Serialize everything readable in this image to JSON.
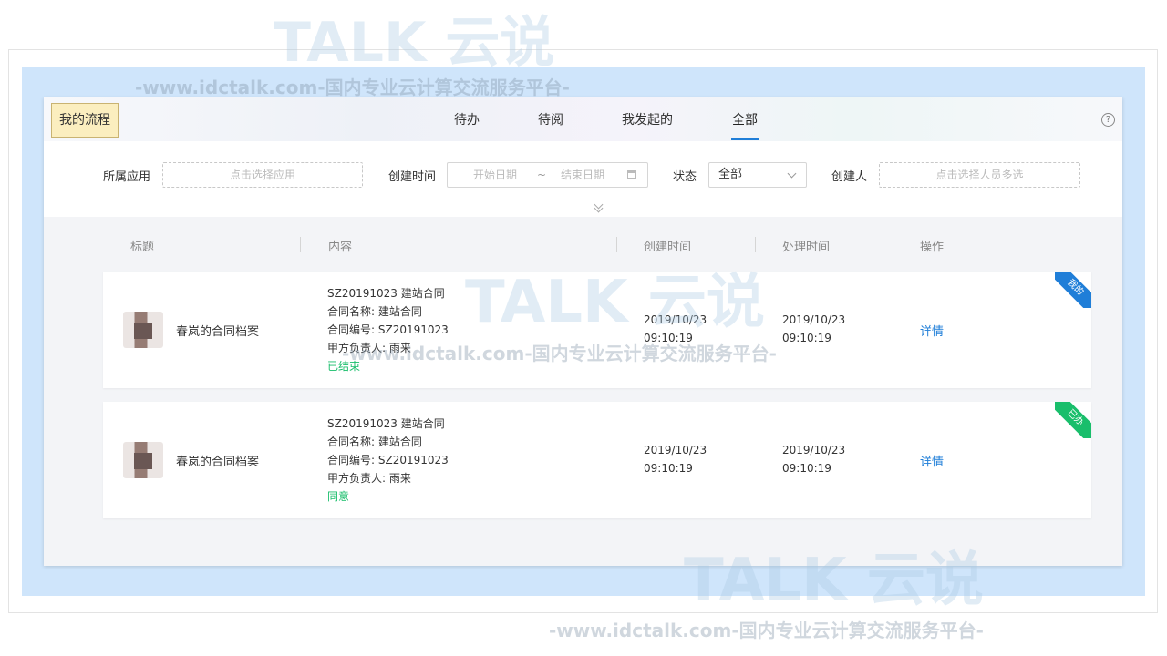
{
  "header": {
    "title": "我的流程",
    "tabs": [
      "待办",
      "待阅",
      "我发起的",
      "全部"
    ],
    "active_tab": "全部",
    "help_symbol": "?"
  },
  "filters": {
    "app_label": "所属应用",
    "app_placeholder": "点击选择应用",
    "created_label": "创建时间",
    "start_placeholder": "开始日期",
    "date_separator": "~",
    "end_placeholder": "结束日期",
    "status_label": "状态",
    "status_value": "全部",
    "creator_label": "创建人",
    "creator_placeholder": "点击选择人员多选"
  },
  "table": {
    "columns": [
      "标题",
      "内容",
      "创建时间",
      "处理时间",
      "操作"
    ],
    "rows": [
      {
        "title": "春岚的合同档案",
        "content": [
          "SZ20191023 建站合同",
          "合同名称: 建站合同",
          "合同编号: SZ20191023",
          "甲方负责人: 雨来"
        ],
        "status": "已结束",
        "created": [
          "2019/10/23",
          "09:10:19"
        ],
        "processed": [
          "2019/10/23",
          "09:10:19"
        ],
        "action": "详情",
        "corner_label": "我的"
      },
      {
        "title": "春岚的合同档案",
        "content": [
          "SZ20191023 建站合同",
          "合同名称: 建站合同",
          "合同编号: SZ20191023",
          "甲方负责人: 雨来"
        ],
        "status": "同意",
        "created": [
          "2019/10/23",
          "09:10:19"
        ],
        "processed": [
          "2019/10/23",
          "09:10:19"
        ],
        "action": "详情",
        "corner_label": "已办"
      }
    ]
  },
  "watermark": {
    "brand": "TALK 云说",
    "url": "-www.idctalk.com-国内专业云计算交流服务平台-"
  },
  "colors": {
    "accent": "#1f7ed8",
    "success": "#19be6b",
    "badge_bg": "#fbeebf",
    "page_bg": "#cfe5fb"
  }
}
